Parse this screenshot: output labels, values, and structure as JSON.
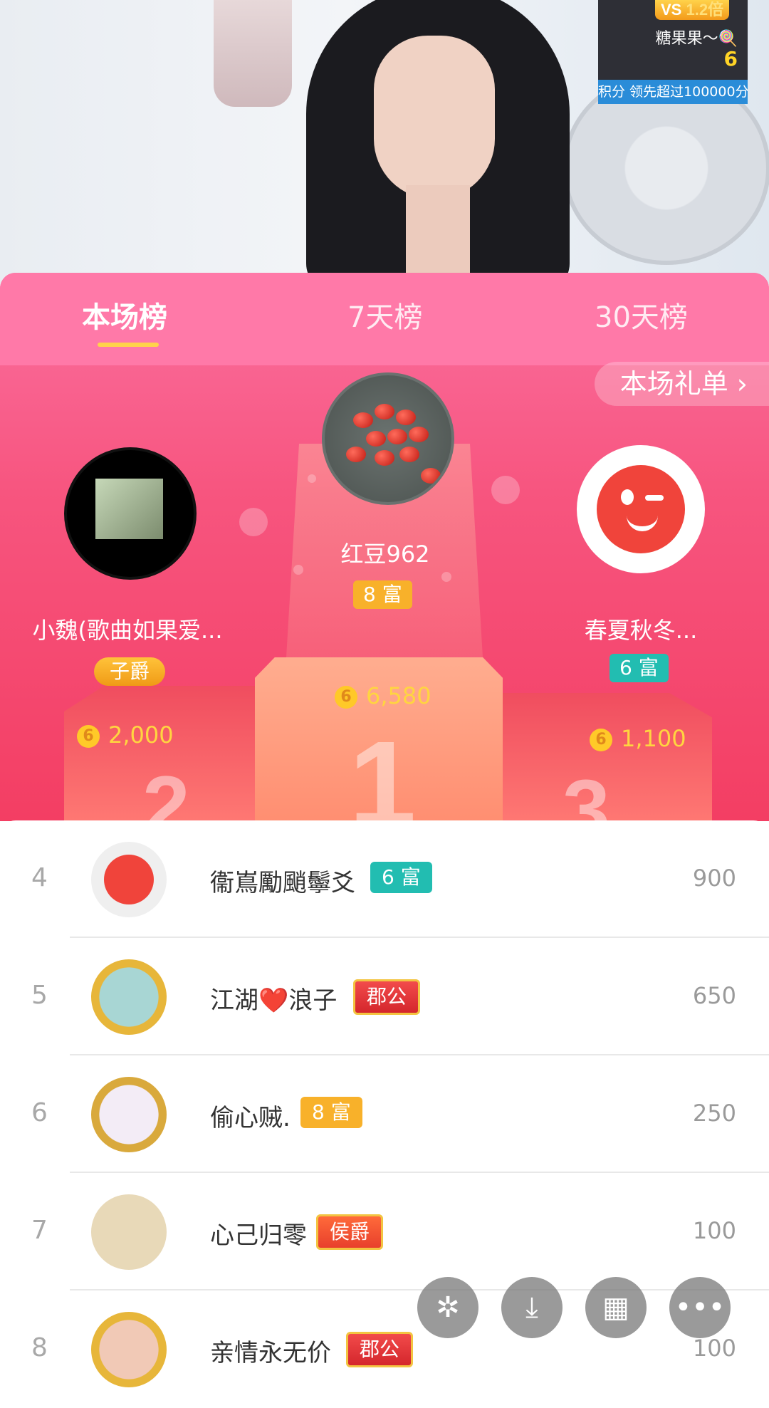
{
  "pk": {
    "vs_label": "VS",
    "multiplier": "1.2倍",
    "opponent_name": "糖果果～🍭",
    "opponent_score": "6",
    "ticker": "积分 领先超过100000分"
  },
  "tabs": [
    {
      "label": "本场榜",
      "active": true
    },
    {
      "label": "7天榜",
      "active": false
    },
    {
      "label": "30天榜",
      "active": false
    }
  ],
  "gift_list_link": "本场礼单 ›",
  "podium": {
    "first": {
      "name": "红豆962",
      "badge": "8 富",
      "score": "6,580",
      "number": "1"
    },
    "second": {
      "name": "小魏(歌曲如果爱...",
      "badge": "子爵",
      "score": "2,000",
      "number": "2"
    },
    "third": {
      "name": "春夏秋冬...",
      "badge": "6 富",
      "score": "1,100",
      "number": "3"
    }
  },
  "coin_symbol": "6",
  "rankings": [
    {
      "rank": "4",
      "name": "衞嶌勵颵鬡爻",
      "badge": "6 富",
      "badge_style": "teal",
      "score": "900"
    },
    {
      "rank": "5",
      "name": "江湖❤️浪子",
      "badge": "郡公",
      "badge_style": "red-title",
      "score": "650"
    },
    {
      "rank": "6",
      "name": "偷心贼.",
      "badge": "8 富",
      "badge_style": "gold",
      "score": "250"
    },
    {
      "rank": "7",
      "name": "心己归零",
      "badge": "侯爵",
      "badge_style": "orange-title",
      "score": "100"
    },
    {
      "rank": "8",
      "name": "亲情永无价",
      "badge": "郡公",
      "badge_style": "red-title",
      "score": "100"
    }
  ],
  "fab_icons": [
    "sparkle-icon",
    "download-icon",
    "grid-icon",
    "more-icon"
  ],
  "colors": {
    "accent_pink": "#ff79a8",
    "tab_indicator": "#ffd34a",
    "coin": "#ffc928"
  }
}
